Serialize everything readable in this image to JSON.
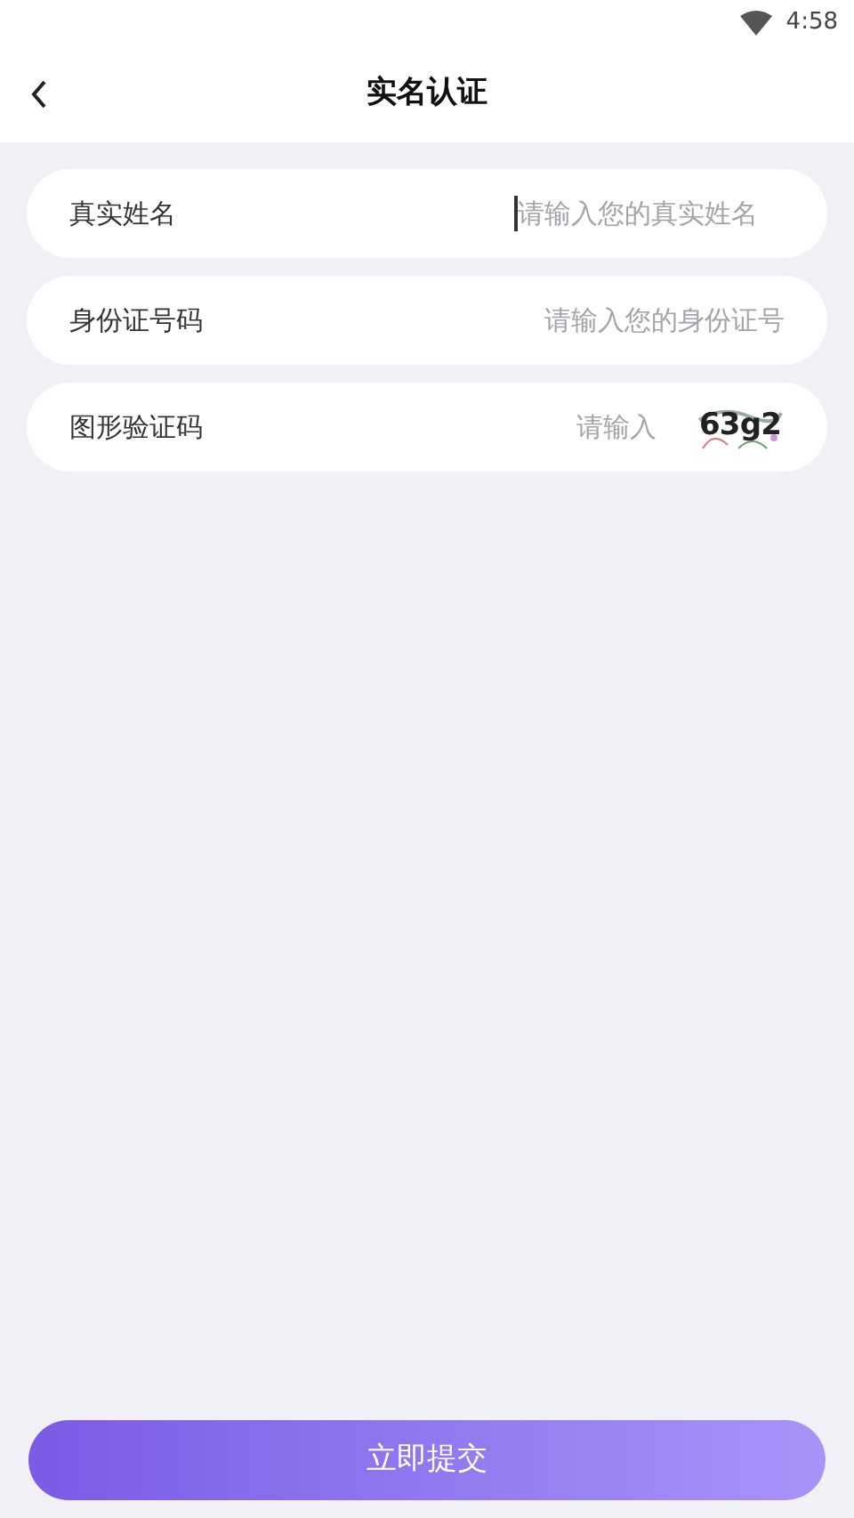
{
  "status_bar": {
    "time": "4:58"
  },
  "header": {
    "title": "实名认证"
  },
  "fields": [
    {
      "kind": "text",
      "label": "真实姓名",
      "placeholder": "请输入您的真实姓名",
      "focused": true
    },
    {
      "kind": "text",
      "label": "身份证号码",
      "placeholder": "请输入您的身份证号",
      "focused": false
    },
    {
      "kind": "captcha",
      "label": "图形验证码",
      "placeholder": "请输入",
      "focused": false,
      "captcha": "63g2"
    }
  ],
  "submit_button": "立即提交"
}
